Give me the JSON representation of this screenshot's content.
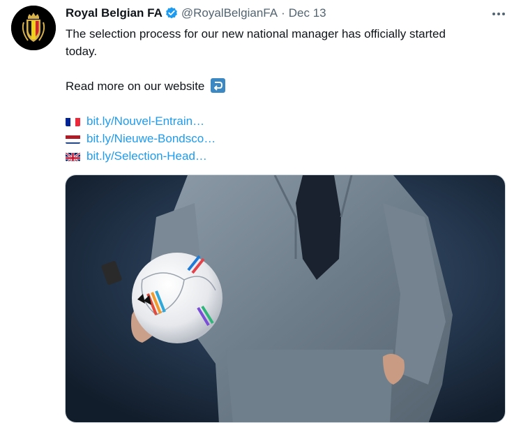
{
  "tweet": {
    "author_name": "Royal Belgian FA",
    "handle": "@RoyalBelgianFA",
    "separator": "·",
    "date": "Dec 13",
    "text_line1": "The selection process for our new national manager has officially started",
    "text_line2": "today.",
    "read_more": "Read more on our website",
    "links": [
      {
        "flag": "france-flag-icon",
        "text": "bit.ly/Nouvel-Entrain…"
      },
      {
        "flag": "netherlands-flag-icon",
        "text": "bit.ly/Nieuwe-Bondsco…"
      },
      {
        "flag": "uk-flag-icon",
        "text": "bit.ly/Selection-Head…"
      }
    ],
    "colors": {
      "link": "#1d9bf0",
      "verified": "#1d9bf0",
      "muted": "#536471"
    }
  }
}
